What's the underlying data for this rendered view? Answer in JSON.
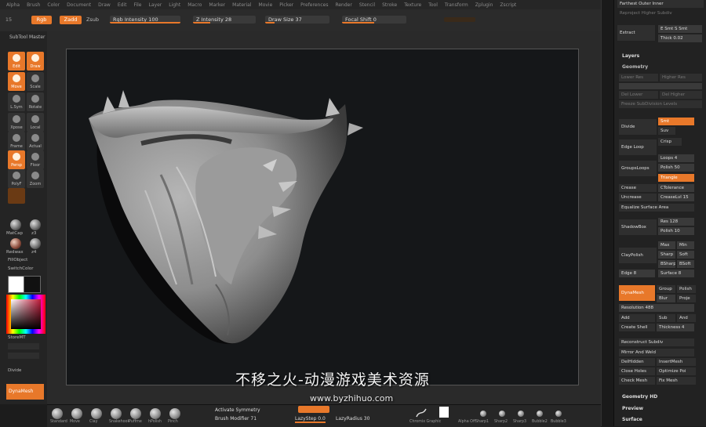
{
  "menu": [
    "Alpha",
    "Brush",
    "Color",
    "Document",
    "Draw",
    "Edit",
    "File",
    "Layer",
    "Light",
    "Macro",
    "Marker",
    "Material",
    "Movie",
    "Picker",
    "Preferences",
    "Render",
    "Stencil",
    "Stroke",
    "Texture",
    "Tool",
    "Transform",
    "Zplugin",
    "Zscript"
  ],
  "topshelf": {
    "rgb": "Rgb",
    "zadd": "Zadd",
    "zsub": "Zsub",
    "rgb_intensity": "Rgb Intensity 100",
    "z_intensity": "Z Intensity 28",
    "draw_size": "Draw Size 37",
    "focal_shift": "Focal Shift 0",
    "left_num": "15"
  },
  "leftshelf": {
    "subtool_master": "SubTool Master",
    "edit": "Edit",
    "draw": "Draw",
    "move": "Move",
    "scale": "Scale",
    "rotate": "Rotate",
    "local": "Local",
    "lsym": "L.Sym",
    "xpose": "Xpose",
    "frame": "Frame",
    "actual": "Actual",
    "persp": "Persp",
    "floor": "Floor",
    "polyf": "PolyF",
    "transp": "Transp",
    "zoom": "Zoom",
    "mat1": "MatCap",
    "mat2": "z3",
    "mat3": "Redwax",
    "mat4": "z4",
    "fill_object": "FillObject",
    "switch_color": "SwitchColor",
    "store_mt": "StoreMT",
    "divide": "Divide",
    "dynamesh": "DynaMesh"
  },
  "rightpanel": {
    "furthest_outer_inner": "Farthest Outer  Inner",
    "project": "Reproject Higher Subdiv",
    "extract": "Extract",
    "e_smt": "E Smt  S Smt",
    "thick": "Thick 0.02",
    "layers": "Layers",
    "geometry": "Geometry",
    "lower_res": "Lower Res",
    "higher_res": "Higher Res",
    "del_lower": "Del Lower",
    "del_higher": "Del Higher",
    "freeze": "Freeze SubDivision Levels",
    "divide": "Divide",
    "smt": "Smt",
    "suv": "Suv",
    "edge_loop": "Edge Loop",
    "crisp": "Crisp",
    "groups_loops": "GroupsLoops",
    "loops": "Loops 4",
    "polish": "Polish 50",
    "triangle": "Triangle",
    "crease": "Crease",
    "uncrease": "Uncrease",
    "tolerance": "CTolerance",
    "crease_lvl": "CreaseLvl 15",
    "equalize": "Equalize Surface Area",
    "shadowbox": "ShadowBox",
    "res": "Res 128",
    "polish2": "Polish 10",
    "claypolish": "ClayPolish",
    "max": "Max",
    "min": "Min",
    "sharp": "Sharp",
    "soft": "Soft",
    "bsharp": "BSharp",
    "bsoft": "BSoft",
    "edge": "Edge 8",
    "surface": "Surface 8",
    "dynamesh": "DynaMesh",
    "group": "Group",
    "polish3": "Polish",
    "blur": "Blur",
    "project2": "Proje",
    "resolution": "Resolution 488",
    "add": "Add",
    "sub": "Sub",
    "and": "And",
    "create_shell": "Create Shell",
    "thickness": "Thickness 4",
    "reconstruct": "Reconstruct Subdiv",
    "mirror_weld": "Mirror And Weld",
    "delhidden": "DelHidden",
    "insertmesh": "InsertMesh",
    "close_holes": "Close Holes",
    "optimize": "Optimize Poi",
    "check_mesh": "Check Mesh",
    "fix_mesh": "Fix Mesh",
    "geometry_hd": "Geometry HD",
    "preview": "Preview",
    "surface2": "Surface"
  },
  "bottomshelf": {
    "brushes": [
      "Standard",
      "Move",
      "Clay",
      "Snakehook",
      "Puffme",
      "hPolish",
      "Pinch"
    ],
    "activate_symmetry": "Activate Symmetry",
    "brush_modifier": "Brush Modifier 71",
    "lazystep": "LazyStep 0.0",
    "lazyradius": "LazyRadius 30",
    "chromix": "Chromix Graphic",
    "alpha_off": "Alpha Off",
    "alphas": [
      "Sharp1",
      "Sharp2",
      "Sharp3",
      "Bubble2",
      "Bubble3"
    ]
  },
  "watermark": {
    "cn": "不移之火-动漫游戏美术资源",
    "url": "www.byzhihuo.com"
  },
  "colors": {
    "accent": "#e8782a",
    "panel": "#222222",
    "canvas": "#151719"
  }
}
